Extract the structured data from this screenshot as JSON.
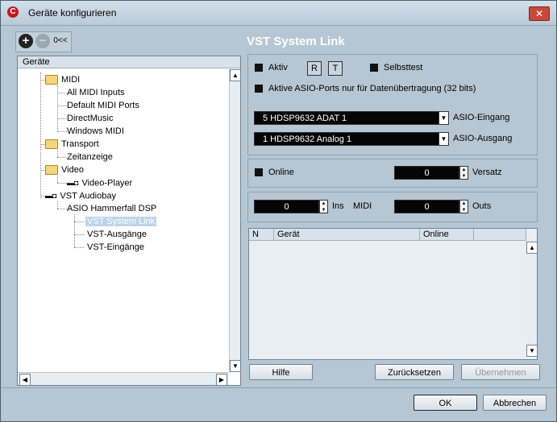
{
  "window": {
    "title": "Geräte konfigurieren",
    "close_label": "✕",
    "app_icon_label": "C"
  },
  "toolbar": {
    "add_label": "+",
    "remove_label": "−",
    "collapse_label": "0<<"
  },
  "tree": {
    "header": "Geräte",
    "items": [
      {
        "label": "MIDI"
      },
      {
        "label": "All MIDI Inputs"
      },
      {
        "label": "Default MIDI Ports"
      },
      {
        "label": "DirectMusic"
      },
      {
        "label": "Windows MIDI"
      },
      {
        "label": "Transport"
      },
      {
        "label": "Zeitanzeige"
      },
      {
        "label": "Video"
      },
      {
        "label": "Video-Player"
      },
      {
        "label": "VST Audiobay"
      },
      {
        "label": "ASIO Hammerfall DSP"
      },
      {
        "label": "VST System Link"
      },
      {
        "label": "VST-Ausgänge"
      },
      {
        "label": "VST-Eingänge"
      }
    ]
  },
  "panel": {
    "title": "VST System Link",
    "aktiv_label": "Aktiv",
    "r_label": "R",
    "t_label": "T",
    "selbsttest_label": "Selbsttest",
    "asio_ports_label": "Aktive ASIO-Ports nur für Datenübertragung (32 bits)",
    "asio_input_value": "5 HDSP9632 ADAT 1",
    "asio_input_label": "ASIO-Eingang",
    "asio_output_value": "1 HDSP9632 Analog 1",
    "asio_output_label": "ASIO-Ausgang",
    "online_label": "Online",
    "versatz_value": "0",
    "versatz_label": "Versatz",
    "ins_value": "0",
    "ins_label": "Ins",
    "midi_label": "MIDI",
    "outs_value": "0",
    "outs_label": "Outs",
    "list_columns": [
      "N",
      "Gerät",
      "Online"
    ]
  },
  "buttons": {
    "hilfe": "Hilfe",
    "zuruecksetzen": "Zurücksetzen",
    "uebernehmen": "Übernehmen",
    "ok": "OK",
    "abbrechen": "Abbrechen"
  }
}
